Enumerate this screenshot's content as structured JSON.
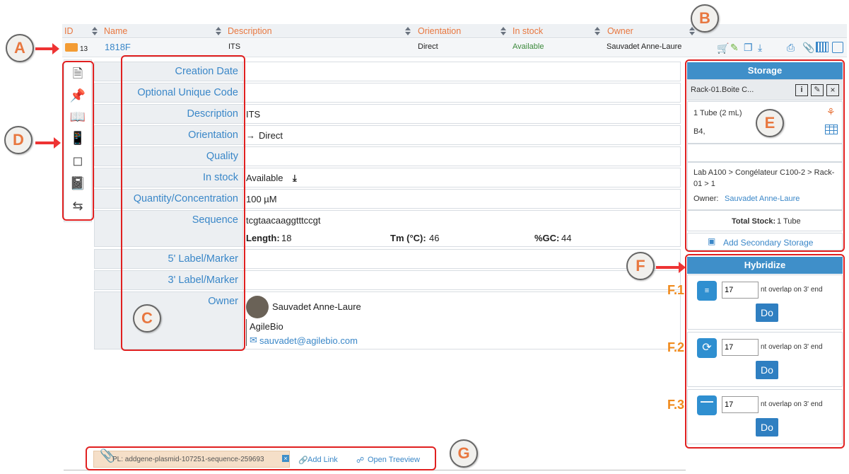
{
  "header": {
    "id": "ID",
    "name": "Name",
    "description": "Description",
    "orientation": "Orientation",
    "in_stock": "In stock",
    "owner": "Owner"
  },
  "row": {
    "count": "13",
    "name": "1818F",
    "description": "ITS",
    "orientation": "Direct",
    "in_stock": "Available",
    "owner": "Sauvadet Anne-Laure"
  },
  "callouts": {
    "a": "A",
    "b": "B",
    "c": "C",
    "d": "D",
    "e": "E",
    "f": "F",
    "g": "G"
  },
  "form": {
    "creation_date": "Creation Date",
    "unique_code": "Optional Unique Code",
    "description": "Description",
    "description_value": "ITS",
    "orientation": "Orientation",
    "orientation_value": "Direct",
    "quality": "Quality",
    "in_stock": "In stock",
    "in_stock_value": "Available",
    "quantity": "Quantity/Concentration",
    "quantity_value": "100 µM",
    "sequence": "Sequence",
    "sequence_value": "tcgtaacaaggtttccgt",
    "length_label": "Length:",
    "length_value": "18",
    "tm_label": "Tm (°C):",
    "tm_value": "46",
    "gc_label": "%GC:",
    "gc_value": "44",
    "label5": "5' Label/Marker",
    "label3": "3' Label/Marker",
    "owner": "Owner",
    "owner_name": "Sauvadet Anne-Laure",
    "owner_org": "AgileBio",
    "owner_email": "sauvadet@agilebio.com"
  },
  "storage": {
    "title": "Storage",
    "location": "Rack-01.Boite C...",
    "tube": "1 Tube (2 mL)",
    "position": "B4,",
    "path": "Lab A100 > Congélateur C100-2 > Rack-01 > 1",
    "owner_label": "Owner:",
    "owner": "Sauvadet Anne-Laure",
    "total_label": "Total Stock:",
    "total_value": "1 Tube",
    "add_secondary": "Add Secondary Storage"
  },
  "hybridize": {
    "title": "Hybridize",
    "overlap_text": "nt overlap on 3' end",
    "do": "Do",
    "rows": [
      {
        "tag": "F.1",
        "value": "17"
      },
      {
        "tag": "F.2",
        "value": "17"
      },
      {
        "tag": "F.3",
        "value": "17"
      }
    ]
  },
  "footer": {
    "attachment": "PL: addgene-plasmid-107251-sequence-259693",
    "add_link": "Add Link",
    "open_treeview": "Open Treeview"
  },
  "colors": {
    "accent": "#3f8fc9",
    "header_text": "#e8773f",
    "highlight": "#e02020"
  }
}
